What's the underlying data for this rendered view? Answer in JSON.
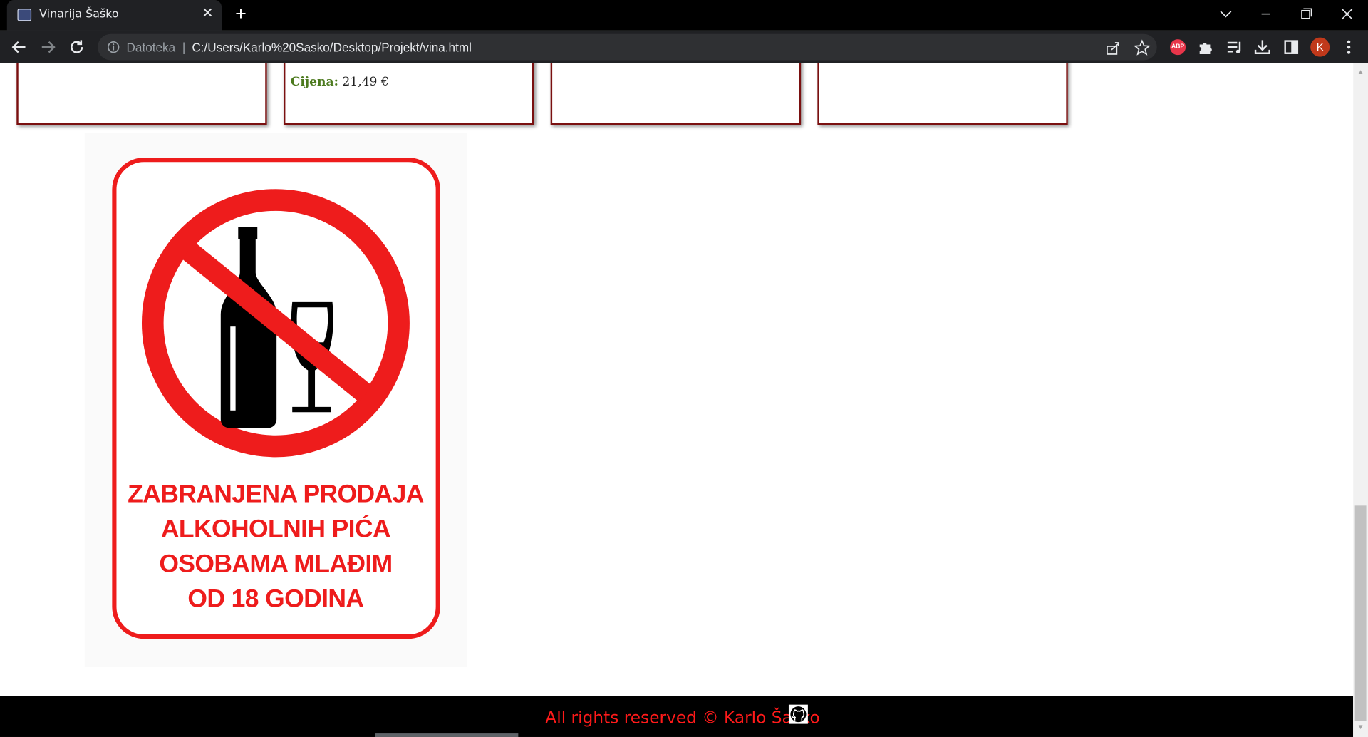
{
  "browser": {
    "tab_title": "Vinarija Šaško",
    "new_tab_label": "+",
    "origin_label": "Datoteka",
    "separator": "|",
    "url": "C:/Users/Karlo%20Sasko/Desktop/Projekt/vina.html",
    "abp_label": "ABP",
    "profile_initial": "K"
  },
  "cards": {
    "price_label": "Cijena:",
    "price_value": "21,49 €"
  },
  "sign": {
    "line1": "ZABRANJENA PRODAJA",
    "line2": "ALKOHOLNIH PIĆA",
    "line3": "OSOBAMA MLAĐIM",
    "line4": "OD 18 GODINA"
  },
  "footer": {
    "text": "All rights reserved © Karlo Šaško"
  },
  "colors": {
    "sign_red": "#ee1c1c",
    "footer_text": "#ff1a1a",
    "price_label": "#4c7a1e",
    "card_border": "#7a1010"
  }
}
